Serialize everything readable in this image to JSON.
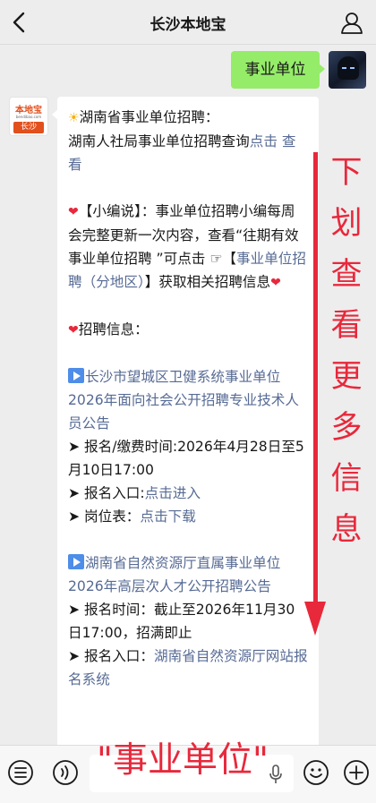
{
  "header": {
    "title": "长沙本地宝"
  },
  "chat": {
    "my_message": "事业单位",
    "bot_avatar": {
      "logo_text": "本地宝",
      "logo_sub": "bendibao.com",
      "tag": "长沙"
    },
    "bubble": {
      "l1_emoji": "☀",
      "l1_text": "湖南省事业单位招聘：",
      "l2_text": "湖南人社局事业单位招聘查询",
      "l2_link_a": "点击",
      "l3_link": "查看",
      "p2_heart": "❤",
      "p2_text_a": "【小编说】：事业单位招聘小编每周会完整更新一次内容，查看“往期有效事业单位招聘 ”可点击",
      "p2_hand": "☞",
      "p2_bracket_open": "【",
      "p2_link": "事业单位招聘（分地区）",
      "p2_text_b": "】获取相关招聘信息",
      "p2_heart_end": "❤",
      "p3_heart": "❤",
      "p3_text": "招聘信息：",
      "item1_title": "长沙市望城区卫健系统事业单位2026年面向社会公开招聘专业技术人员公告",
      "item1_line1": "➤ 报名/缴费时间:2026年4月28日至5月10日17:00",
      "item1_line2_label": "➤ 报名入口:",
      "item1_line2_link": "点击进入",
      "item1_line3_label": "➤ 岗位表：",
      "item1_line3_link": "点击下载",
      "item2_title": "湖南省自然资源厅直属事业单位2026年高层次人才公开招聘公告",
      "item2_line1": "➤ 报名时间：截止至2026年11月30日17:00，招满即止",
      "item2_line2_label": "➤ 报名入口：",
      "item2_line2_link": "湖南省自然资源厅网站报名系统"
    }
  },
  "overlay": {
    "side_text": "下划查看更多信息",
    "bottom_text": "\"事业单位\""
  },
  "colors": {
    "link": "#576b95",
    "overlay_red": "#e8283b",
    "my_bubble": "#95ec69"
  },
  "icons": [
    "back-icon",
    "profile-icon",
    "keyboard-icon",
    "voice-icon",
    "mic-icon",
    "emoji-icon",
    "plus-icon"
  ]
}
